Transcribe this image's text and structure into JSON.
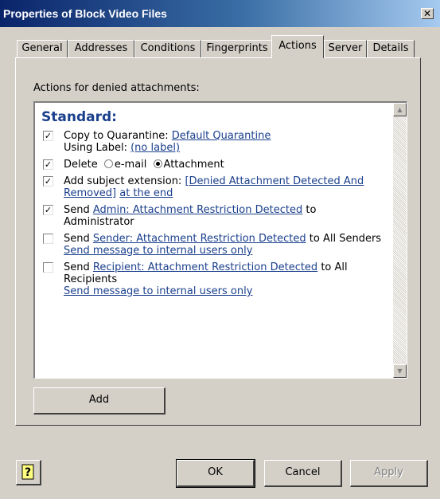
{
  "window": {
    "title": "Properties of Block Video Files",
    "close_glyph": "✕"
  },
  "tabs": [
    {
      "label": "General"
    },
    {
      "label": "Addresses"
    },
    {
      "label": "Conditions"
    },
    {
      "label": "Fingerprints"
    },
    {
      "label": "Actions",
      "active": true
    },
    {
      "label": "Server"
    },
    {
      "label": "Details"
    }
  ],
  "actions": {
    "caption": "Actions for denied attachments:",
    "heading": "Standard:",
    "rows": {
      "quarantine": {
        "checked": true,
        "prefix": "Copy to Quarantine: ",
        "link": "Default Quarantine",
        "label_prefix": "Using Label: ",
        "label_link": "(no label)"
      },
      "delete": {
        "checked": true,
        "prefix": "Delete",
        "opt_email": "e-mail",
        "opt_attachment": "Attachment",
        "selected": "Attachment"
      },
      "subject": {
        "checked": true,
        "prefix": "Add subject extension: ",
        "link": "[Denied Attachment Detected And Removed]",
        "suffix_link": "at the end"
      },
      "admin": {
        "checked": true,
        "prefix": "Send ",
        "link": "Admin: Attachment Restriction Detected",
        "suffix": " to Administrator"
      },
      "sender": {
        "checked": false,
        "prefix": "Send ",
        "link": "Sender: Attachment Restriction Detected",
        "suffix": " to All Senders",
        "sub_link": "Send message to internal users only"
      },
      "recipient": {
        "checked": false,
        "prefix": "Send ",
        "link": "Recipient: Attachment Restriction Detected",
        "suffix": " to All Recipients",
        "sub_link": "Send message to internal users only"
      }
    }
  },
  "buttons": {
    "add": "Add",
    "ok": "OK",
    "cancel": "Cancel",
    "apply": "Apply",
    "help_icon": "help-icon"
  },
  "colors": {
    "link": "#1a3f8c",
    "face": "#d4d0c8",
    "title_start": "#0a246a",
    "title_end": "#a6caf0"
  }
}
